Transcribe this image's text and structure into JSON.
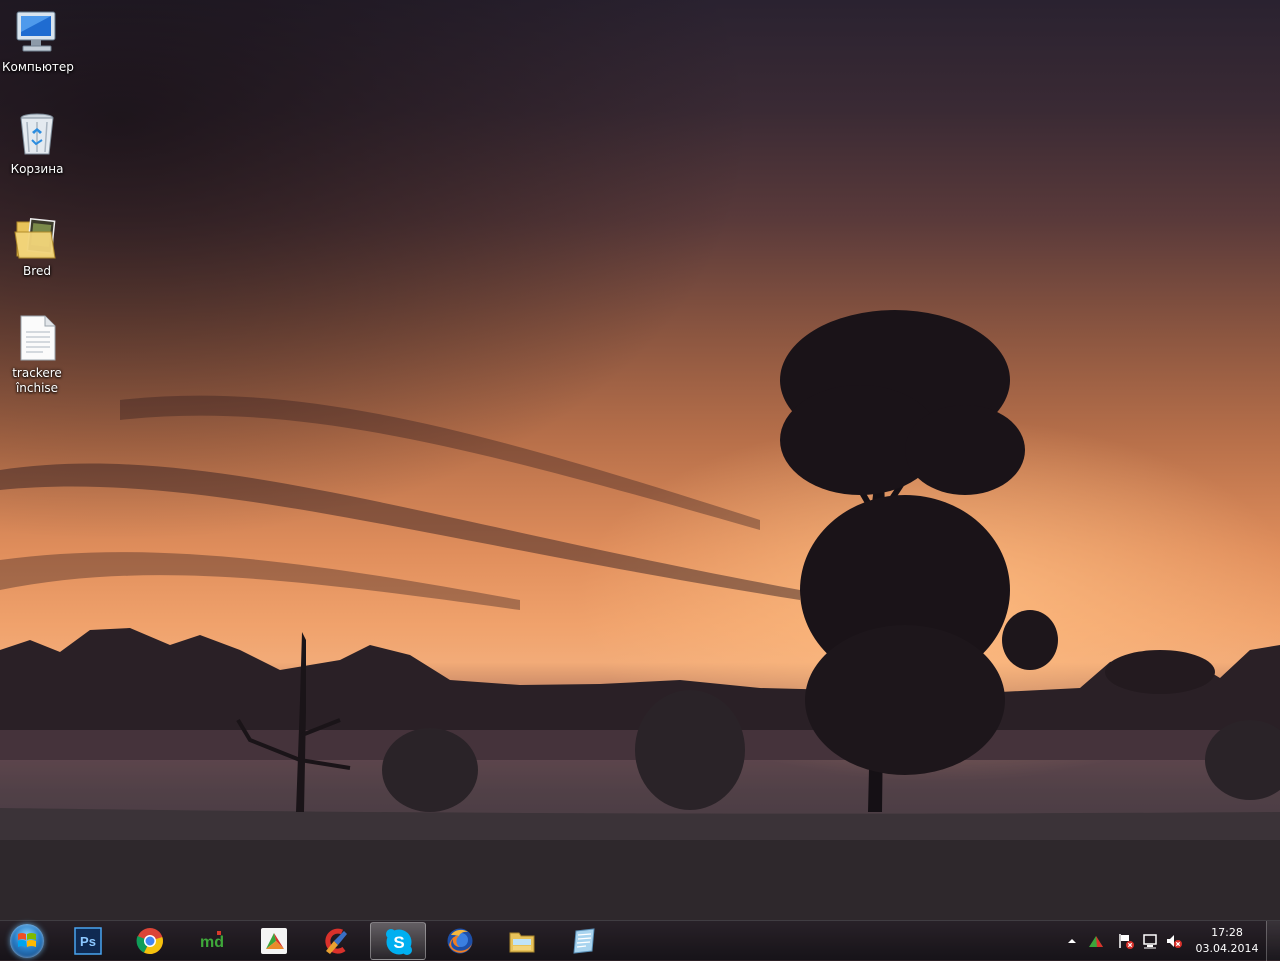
{
  "desktop": {
    "icons": [
      {
        "label": "Компьютер",
        "icon": "computer-icon"
      },
      {
        "label": "Корзина",
        "icon": "recycle-bin-icon"
      },
      {
        "label": "Bred",
        "icon": "folder-icon"
      },
      {
        "label": "trackere închise",
        "icon": "text-document-icon"
      }
    ]
  },
  "taskbar": {
    "start": {
      "icon": "windows-start-orb-icon"
    },
    "pinned": [
      {
        "name": "Photoshop",
        "icon": "photoshop-icon",
        "glyph": "Ps"
      },
      {
        "name": "Chrome",
        "icon": "chrome-icon"
      },
      {
        "name": "md",
        "icon": "md-app-icon",
        "glyph": "md"
      },
      {
        "name": "Media Player",
        "icon": "media-player-icon"
      },
      {
        "name": "CCleaner",
        "icon": "ccleaner-icon"
      },
      {
        "name": "Skype",
        "icon": "skype-icon",
        "glyph": "S"
      },
      {
        "name": "Firefox",
        "icon": "firefox-icon"
      },
      {
        "name": "Explorer",
        "icon": "file-explorer-icon"
      },
      {
        "name": "Notes",
        "icon": "notepad-icon"
      }
    ],
    "active_item": "Skype",
    "tray": {
      "icons": [
        "show-hidden-icons-arrow",
        "tray-app-icon",
        "action-center-flag-icon",
        "network-icon",
        "volume-muted-icon"
      ],
      "time": "17:28",
      "date": "03.04.2014"
    }
  },
  "colors": {
    "sky_glow": "#f2ab78",
    "taskbar": "#1c1820",
    "skype_blue": "#00aff0",
    "photoshop_blue": "#0f2a52"
  }
}
